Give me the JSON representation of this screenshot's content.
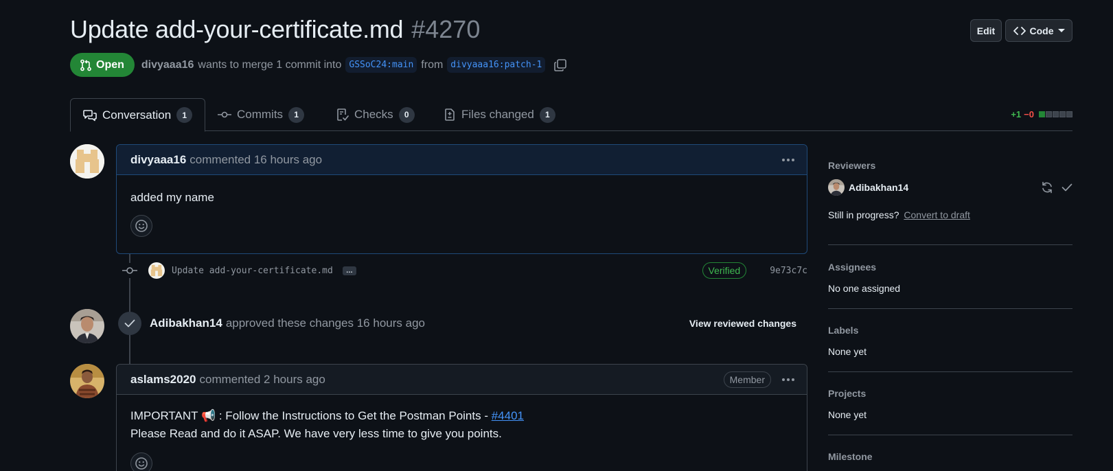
{
  "header": {
    "title": "Update add-your-certificate.md",
    "number": "#4270",
    "edit_label": "Edit",
    "code_label": "Code"
  },
  "meta": {
    "state": "Open",
    "author": "divyaaa16",
    "action_text": "wants to merge 1 commit into",
    "base_branch": "GSSoC24:main",
    "from_text": "from",
    "head_branch": "divyaaa16:patch-1"
  },
  "tabs": [
    {
      "label": "Conversation",
      "count": "1"
    },
    {
      "label": "Commits",
      "count": "1"
    },
    {
      "label": "Checks",
      "count": "0"
    },
    {
      "label": "Files changed",
      "count": "1"
    }
  ],
  "diffstat": {
    "additions": "+1",
    "deletions": "−0",
    "filled_blocks": 1,
    "total_blocks": 5
  },
  "timeline": {
    "comment1": {
      "author": "divyaaa16",
      "meta": "commented 16 hours ago",
      "body": "added my name"
    },
    "commit": {
      "message": "Update add-your-certificate.md",
      "ellipsis": "…",
      "verified_label": "Verified",
      "sha": "9e73c7c"
    },
    "review": {
      "author": "Adibakhan14",
      "text": "approved these changes 16 hours ago",
      "view_label": "View reviewed changes"
    },
    "comment2": {
      "author": "aslams2020",
      "meta": "commented 2 hours ago",
      "badge": "Member",
      "line1_prefix": "IMPORTANT ",
      "line1_emoji": "📢",
      "line1_text": " : Follow the Instructions to Get the Postman Points - ",
      "line1_link": "#4401",
      "line2": "Please Read and do it ASAP. We have very less time to give you points."
    }
  },
  "sidebar": {
    "reviewers_heading": "Reviewers",
    "reviewer_name": "Adibakhan14",
    "in_progress": "Still in progress?",
    "convert_draft": "Convert to draft",
    "assignees_heading": "Assignees",
    "assignees_value": "No one assigned",
    "labels_heading": "Labels",
    "labels_value": "None yet",
    "projects_heading": "Projects",
    "projects_value": "None yet",
    "milestone_heading": "Milestone"
  },
  "colors": {
    "background": "#0d1117",
    "open_green": "#238636",
    "link_blue": "#4493f8",
    "danger_red": "#f85149"
  }
}
